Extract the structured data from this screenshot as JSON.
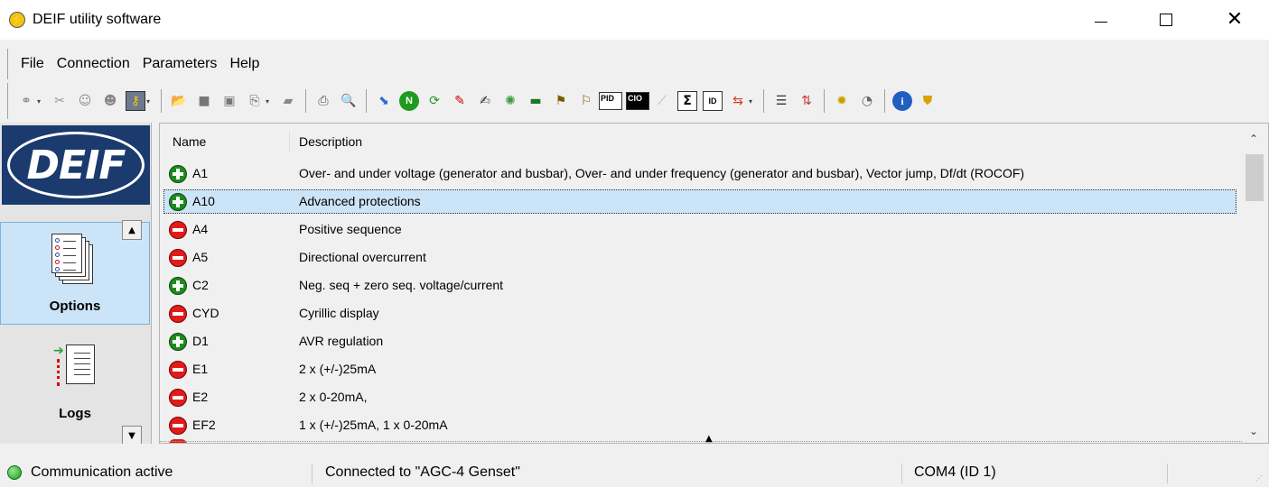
{
  "window": {
    "title": "DEIF utility software",
    "minimize_icon": "minimize-icon",
    "maximize_icon": "maximize-icon",
    "close_icon": "close-icon"
  },
  "menu": {
    "items": [
      "File",
      "Connection",
      "Parameters",
      "Help"
    ]
  },
  "toolbar": {
    "pid_label": "PID",
    "cio_label": "CIO",
    "sum_label": "Σ",
    "id_label": "ID",
    "n_label": "N"
  },
  "sidebar": {
    "logo_text": "DEIF",
    "items": [
      {
        "label": "Options",
        "icon": "options-icon",
        "selected": true
      },
      {
        "label": "Logs",
        "icon": "logs-icon",
        "selected": false
      }
    ]
  },
  "list": {
    "columns": {
      "name": "Name",
      "description": "Description"
    },
    "rows": [
      {
        "name": "A1",
        "description": "Over- and under voltage (generator and busbar), Over- and under frequency (generator and busbar), Vector jump, Df/dt (ROCOF)",
        "enabled": true
      },
      {
        "name": "A10",
        "description": "Advanced protections",
        "enabled": true,
        "selected": true
      },
      {
        "name": "A4",
        "description": "Positive sequence",
        "enabled": false
      },
      {
        "name": "A5",
        "description": "Directional overcurrent",
        "enabled": false
      },
      {
        "name": "C2",
        "description": "Neg. seq + zero seq. voltage/current",
        "enabled": true
      },
      {
        "name": "CYD",
        "description": "Cyrillic display",
        "enabled": false
      },
      {
        "name": "D1",
        "description": "AVR regulation",
        "enabled": true
      },
      {
        "name": "E1",
        "description": "2 x (+/-)25mA",
        "enabled": false
      },
      {
        "name": "E2",
        "description": "2 x 0-20mA,",
        "enabled": false
      },
      {
        "name": "EF2",
        "description": "1 x (+/-)25mA, 1 x 0-20mA",
        "enabled": false
      }
    ]
  },
  "statusbar": {
    "communication": "Communication active",
    "connection": "Connected to \"AGC-4 Genset\"",
    "port": "COM4 (ID 1)"
  },
  "colors": {
    "enabled": "#1f8a1f",
    "disabled": "#e11b1b",
    "selection": "#cce4f7",
    "logo_bg": "#1b3a6e"
  }
}
